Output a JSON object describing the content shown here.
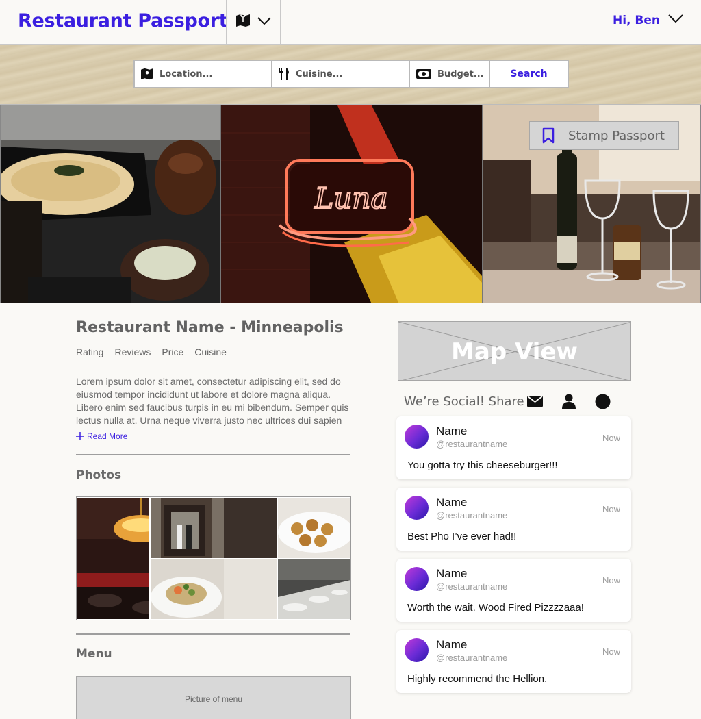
{
  "header": {
    "logo": "Restaurant Passport",
    "map_icon": "map-icon",
    "greeting": "Hi, Ben"
  },
  "search": {
    "location_placeholder": "Location...",
    "cuisine_placeholder": "Cuisine...",
    "budget_placeholder": "Budget...",
    "button_label": "Search"
  },
  "hero": {
    "stamp_label": "Stamp Passport",
    "sign_text": "Luna"
  },
  "restaurant": {
    "name": "Restaurant Name - Minneapolis",
    "meta": [
      "Rating",
      "Reviews",
      "Price",
      "Cuisine"
    ],
    "description": "Lorem ipsum dolor sit amet, consectetur adipiscing elit, sed do eiusmod tempor incididunt ut labore et dolore magna aliqua. Libero enim sed faucibus turpis in eu mi bibendum. Semper quis lectus nulla at. Urna neque viverra justo nec ultrices dui sapien eget mi proin sed libero.",
    "read_more": "Read More"
  },
  "photos": {
    "heading": "Photos"
  },
  "menu": {
    "heading": "Menu",
    "placeholder": "Picture of menu"
  },
  "map": {
    "label": "Map View"
  },
  "social": {
    "label": "We’re Social! Share",
    "icons": [
      "mail-icon",
      "person-icon",
      "circle-icon"
    ]
  },
  "posts": [
    {
      "name": "Name",
      "handle": "@restaurantname",
      "time": "Now",
      "text": "You gotta try this cheeseburger!!!"
    },
    {
      "name": "Name",
      "handle": "@restaurantname",
      "time": "Now",
      "text": "Best Pho I’ve ever had!!"
    },
    {
      "name": "Name",
      "handle": "@restaurantname",
      "time": "Now",
      "text": "Worth the wait. Wood Fired Pizzzzaaa!"
    },
    {
      "name": "Name",
      "handle": "@restaurantname",
      "time": "Now",
      "text": "Highly recommend the Hellion."
    }
  ],
  "colors": {
    "brand": "#3b1fe0",
    "background": "#faf9f6",
    "avatar_gradient": [
      "#c23ad8",
      "#6a2bd6",
      "#2b18a8"
    ]
  }
}
